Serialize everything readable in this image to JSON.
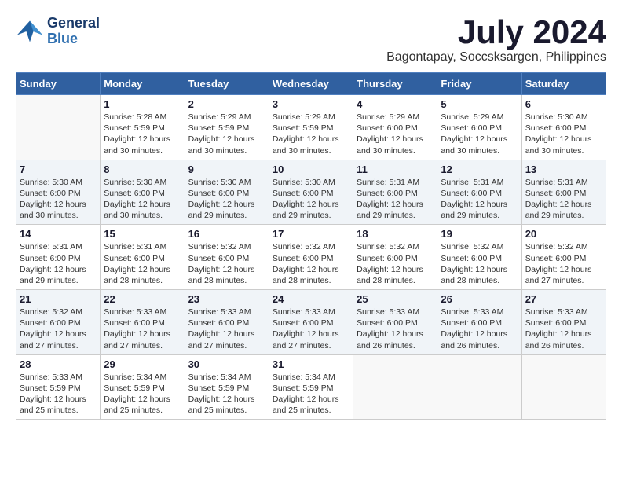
{
  "header": {
    "logo_line1": "General",
    "logo_line2": "Blue",
    "month": "July 2024",
    "location": "Bagontapay, Soccsksargen, Philippines"
  },
  "weekdays": [
    "Sunday",
    "Monday",
    "Tuesday",
    "Wednesday",
    "Thursday",
    "Friday",
    "Saturday"
  ],
  "weeks": [
    [
      {
        "day": "",
        "info": ""
      },
      {
        "day": "1",
        "info": "Sunrise: 5:28 AM\nSunset: 5:59 PM\nDaylight: 12 hours and 30 minutes."
      },
      {
        "day": "2",
        "info": "Sunrise: 5:29 AM\nSunset: 5:59 PM\nDaylight: 12 hours and 30 minutes."
      },
      {
        "day": "3",
        "info": "Sunrise: 5:29 AM\nSunset: 5:59 PM\nDaylight: 12 hours and 30 minutes."
      },
      {
        "day": "4",
        "info": "Sunrise: 5:29 AM\nSunset: 6:00 PM\nDaylight: 12 hours and 30 minutes."
      },
      {
        "day": "5",
        "info": "Sunrise: 5:29 AM\nSunset: 6:00 PM\nDaylight: 12 hours and 30 minutes."
      },
      {
        "day": "6",
        "info": "Sunrise: 5:30 AM\nSunset: 6:00 PM\nDaylight: 12 hours and 30 minutes."
      }
    ],
    [
      {
        "day": "7",
        "info": "Sunrise: 5:30 AM\nSunset: 6:00 PM\nDaylight: 12 hours and 30 minutes."
      },
      {
        "day": "8",
        "info": "Sunrise: 5:30 AM\nSunset: 6:00 PM\nDaylight: 12 hours and 30 minutes."
      },
      {
        "day": "9",
        "info": "Sunrise: 5:30 AM\nSunset: 6:00 PM\nDaylight: 12 hours and 29 minutes."
      },
      {
        "day": "10",
        "info": "Sunrise: 5:30 AM\nSunset: 6:00 PM\nDaylight: 12 hours and 29 minutes."
      },
      {
        "day": "11",
        "info": "Sunrise: 5:31 AM\nSunset: 6:00 PM\nDaylight: 12 hours and 29 minutes."
      },
      {
        "day": "12",
        "info": "Sunrise: 5:31 AM\nSunset: 6:00 PM\nDaylight: 12 hours and 29 minutes."
      },
      {
        "day": "13",
        "info": "Sunrise: 5:31 AM\nSunset: 6:00 PM\nDaylight: 12 hours and 29 minutes."
      }
    ],
    [
      {
        "day": "14",
        "info": "Sunrise: 5:31 AM\nSunset: 6:00 PM\nDaylight: 12 hours and 29 minutes."
      },
      {
        "day": "15",
        "info": "Sunrise: 5:31 AM\nSunset: 6:00 PM\nDaylight: 12 hours and 28 minutes."
      },
      {
        "day": "16",
        "info": "Sunrise: 5:32 AM\nSunset: 6:00 PM\nDaylight: 12 hours and 28 minutes."
      },
      {
        "day": "17",
        "info": "Sunrise: 5:32 AM\nSunset: 6:00 PM\nDaylight: 12 hours and 28 minutes."
      },
      {
        "day": "18",
        "info": "Sunrise: 5:32 AM\nSunset: 6:00 PM\nDaylight: 12 hours and 28 minutes."
      },
      {
        "day": "19",
        "info": "Sunrise: 5:32 AM\nSunset: 6:00 PM\nDaylight: 12 hours and 28 minutes."
      },
      {
        "day": "20",
        "info": "Sunrise: 5:32 AM\nSunset: 6:00 PM\nDaylight: 12 hours and 27 minutes."
      }
    ],
    [
      {
        "day": "21",
        "info": "Sunrise: 5:32 AM\nSunset: 6:00 PM\nDaylight: 12 hours and 27 minutes."
      },
      {
        "day": "22",
        "info": "Sunrise: 5:33 AM\nSunset: 6:00 PM\nDaylight: 12 hours and 27 minutes."
      },
      {
        "day": "23",
        "info": "Sunrise: 5:33 AM\nSunset: 6:00 PM\nDaylight: 12 hours and 27 minutes."
      },
      {
        "day": "24",
        "info": "Sunrise: 5:33 AM\nSunset: 6:00 PM\nDaylight: 12 hours and 27 minutes."
      },
      {
        "day": "25",
        "info": "Sunrise: 5:33 AM\nSunset: 6:00 PM\nDaylight: 12 hours and 26 minutes."
      },
      {
        "day": "26",
        "info": "Sunrise: 5:33 AM\nSunset: 6:00 PM\nDaylight: 12 hours and 26 minutes."
      },
      {
        "day": "27",
        "info": "Sunrise: 5:33 AM\nSunset: 6:00 PM\nDaylight: 12 hours and 26 minutes."
      }
    ],
    [
      {
        "day": "28",
        "info": "Sunrise: 5:33 AM\nSunset: 5:59 PM\nDaylight: 12 hours and 25 minutes."
      },
      {
        "day": "29",
        "info": "Sunrise: 5:34 AM\nSunset: 5:59 PM\nDaylight: 12 hours and 25 minutes."
      },
      {
        "day": "30",
        "info": "Sunrise: 5:34 AM\nSunset: 5:59 PM\nDaylight: 12 hours and 25 minutes."
      },
      {
        "day": "31",
        "info": "Sunrise: 5:34 AM\nSunset: 5:59 PM\nDaylight: 12 hours and 25 minutes."
      },
      {
        "day": "",
        "info": ""
      },
      {
        "day": "",
        "info": ""
      },
      {
        "day": "",
        "info": ""
      }
    ]
  ]
}
